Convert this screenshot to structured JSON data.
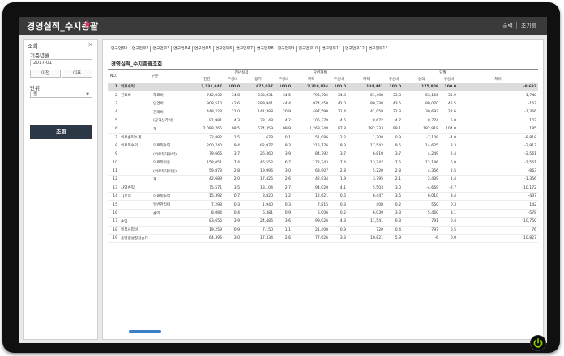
{
  "window": {
    "title": "경영실적_수지총괄",
    "buttons": [
      "출력",
      "초기화"
    ]
  },
  "left_panel": {
    "title": "조회",
    "period_label": "기준년월",
    "period_value": "2017-01",
    "prev_btn": "이전",
    "next_btn": "이후",
    "unit_label": "단위",
    "unit_value": "원",
    "search_btn": "조회"
  },
  "tabs": [
    "연구업무1",
    "연구업무2",
    "연구업무3",
    "연구업무4",
    "연구업무5",
    "연구업무6",
    "연구업무7",
    "연구업무8",
    "연구업무9",
    "연구업무10",
    "연구업무11",
    "연구업무12",
    "연구업무13"
  ],
  "page_title": "경영실적_수지총괄조회",
  "table": {
    "group_headers": [
      "전년실적",
      "당년계획",
      "당월"
    ],
    "no_header": "NO.",
    "cat_header": "구분",
    "sub_headers": [
      "연간",
      "구성비",
      "동기",
      "구성비",
      "계획",
      "구성비",
      "계획",
      "구성비",
      "실적",
      "구성비",
      "차이"
    ],
    "rows": [
      {
        "no": "1",
        "c1": "의료수익",
        "c2": "",
        "v": [
          "2,131,647",
          "100.0",
          "675,037",
          "100.0",
          "2,319,834",
          "100.0",
          "184,441",
          "100.0",
          "175,809",
          "100.0",
          "-8,632"
        ]
      },
      {
        "no": "2",
        "c1": "진료비",
        "c2": "재료비",
        "v": [
          "742,032",
          "34.8",
          "233,031",
          "34.5",
          "796,706",
          "34.3",
          "61,408",
          "33.3",
          "63,156",
          "35.9",
          "1,748"
        ]
      },
      {
        "no": "3",
        "c1": "",
        "c2": "인건비",
        "v": [
          "908,510",
          "42.6",
          "289,941",
          "44.4",
          "974,450",
          "42.0",
          "80,238",
          "43.5",
          "80,070",
          "45.5",
          "-167"
        ]
      },
      {
        "no": "4",
        "c1": "",
        "c2": "관리비",
        "v": [
          "448,223",
          "21.0",
          "141,388",
          "20.9",
          "497,590",
          "21.4",
          "41,058",
          "22.3",
          "39,692",
          "22.6",
          "-1,366"
        ]
      },
      {
        "no": "5",
        "c1": "",
        "c2": "(감가상각비)",
        "v": [
          "91,981",
          "4.3",
          "28,148",
          "4.2",
          "105,378",
          "4.5",
          "8,672",
          "4.7",
          "8,774",
          "5.0",
          "102"
        ]
      },
      {
        "no": "6",
        "c1": "",
        "c2": "계",
        "v": [
          "2,098,765",
          "98.5",
          "674,359",
          "99.9",
          "2,268,748",
          "97.8",
          "182,733",
          "99.1",
          "182,918",
          "104.0",
          "185"
        ]
      },
      {
        "no": "7",
        "c1": "의료손익소계",
        "c2": "",
        "v": [
          "32,882",
          "1.5",
          "678",
          "0.1",
          "51,086",
          "2.2",
          "1,708",
          "0.9",
          "-7,109",
          "-4.0",
          "-8,818"
        ]
      },
      {
        "no": "8",
        "c1": "의료외수익",
        "c2": "의료외수익",
        "v": [
          "200,740",
          "9.4",
          "62,977",
          "9.3",
          "215,176",
          "9.3",
          "17,542",
          "9.5",
          "14,625",
          "8.3",
          "-2,917"
        ]
      },
      {
        "no": "9",
        "c1": "",
        "c2": "(의료부대수익)",
        "v": [
          "79,665",
          "3.7",
          "26,360",
          "3.9",
          "84,792",
          "3.7",
          "6,810",
          "3.7",
          "4,249",
          "2.4",
          "-2,561"
        ]
      },
      {
        "no": "10",
        "c1": "",
        "c2": "의료외비용",
        "v": [
          "158,051",
          "7.4",
          "45,552",
          "6.7",
          "172,243",
          "7.4",
          "13,747",
          "7.5",
          "12,186",
          "6.9",
          "-1,561"
        ]
      },
      {
        "no": "11",
        "c1": "",
        "c2": "(의료부대비용)",
        "v": [
          "59,873",
          "2.8",
          "19,996",
          "3.0",
          "63,907",
          "2.8",
          "5,220",
          "2.8",
          "4,356",
          "2.5",
          "-863"
        ]
      },
      {
        "no": "12",
        "c1": "",
        "c2": "계",
        "v": [
          "42,689",
          "2.0",
          "17,425",
          "2.6",
          "42,934",
          "1.9",
          "3,795",
          "2.1",
          "2,439",
          "1.4",
          "-1,356"
        ]
      },
      {
        "no": "13",
        "c1": "사업손익",
        "c2": "",
        "v": [
          "75,571",
          "3.5",
          "18,104",
          "2.7",
          "94,020",
          "4.1",
          "5,503",
          "3.0",
          "-4,669",
          "-2.7",
          "-10,172"
        ]
      },
      {
        "no": "14",
        "c1": "사후처",
        "c2": "의료외수익",
        "v": [
          "15,392",
          "0.7",
          "8,820",
          "1.2",
          "12,621",
          "0.6",
          "6,447",
          "3.5",
          "6,010",
          "3.4",
          "-437"
        ]
      },
      {
        "no": "15",
        "c1": "",
        "c2": "일반관리비",
        "v": [
          "7,298",
          "0.3",
          "1,940",
          "0.3",
          "7,815",
          "0.3",
          "408",
          "0.2",
          "550",
          "0.3",
          "142"
        ]
      },
      {
        "no": "16",
        "c1": "",
        "c2": "손익",
        "v": [
          "8,084",
          "0.4",
          "6,381",
          "0.9",
          "5,006",
          "0.2",
          "6,039",
          "3.3",
          "5,460",
          "3.1",
          "-578"
        ]
      },
      {
        "no": "17",
        "c1": "손익",
        "c2": "",
        "v": [
          "83,655",
          "3.9",
          "24,485",
          "3.6",
          "99,026",
          "4.3",
          "11,541",
          "6.3",
          "791",
          "0.4",
          "-10,750"
        ]
      },
      {
        "no": "18",
        "c1": "목적사업비",
        "c2": "",
        "v": [
          "19,259",
          "0.9",
          "7,150",
          "1.1",
          "21,400",
          "0.9",
          "720",
          "0.4",
          "797",
          "0.5",
          "76"
        ]
      },
      {
        "no": "19",
        "c1": "운영결설정전손다",
        "c2": "",
        "v": [
          "64,396",
          "3.0",
          "17,334",
          "2.6",
          "77,626",
          "3.3",
          "10,821",
          "5.9",
          "-6",
          "0.0",
          "-10,827"
        ]
      }
    ]
  },
  "colors": {
    "title_bar": "#3a3a3a",
    "star": "#e0325b",
    "search_button": "#2c3846",
    "scroll_thumb": "#3b7fc4",
    "power": "#8fd400"
  }
}
